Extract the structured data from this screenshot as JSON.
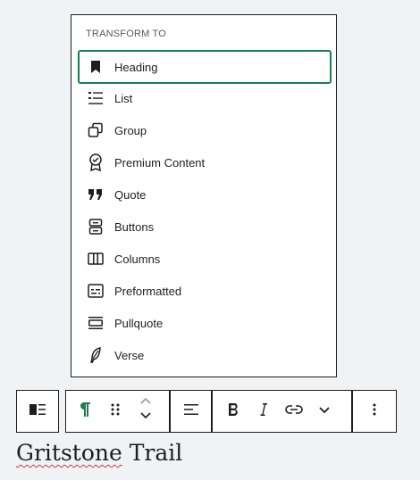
{
  "popover": {
    "title": "TRANSFORM TO",
    "items": [
      {
        "label": "Heading",
        "icon": "bookmark-icon",
        "selected": true
      },
      {
        "label": "List",
        "icon": "list-icon"
      },
      {
        "label": "Group",
        "icon": "group-icon"
      },
      {
        "label": "Premium Content",
        "icon": "premium-badge-icon"
      },
      {
        "label": "Quote",
        "icon": "quote-icon"
      },
      {
        "label": "Buttons",
        "icon": "buttons-icon"
      },
      {
        "label": "Columns",
        "icon": "columns-icon"
      },
      {
        "label": "Preformatted",
        "icon": "preformatted-icon"
      },
      {
        "label": "Pullquote",
        "icon": "pullquote-icon"
      },
      {
        "label": "Verse",
        "icon": "feather-icon"
      }
    ]
  },
  "toolbar": {
    "buttons": [
      "block-layout-icon",
      "paragraph-icon",
      "drag-handle-icon",
      "move-up-down-icon",
      "align-left-icon",
      "bold-icon",
      "italic-icon",
      "link-icon",
      "chevron-down-icon",
      "more-options-icon"
    ]
  },
  "content": {
    "title_word1": "Gritstone",
    "title_word2": " Trail"
  },
  "colors": {
    "accent": "#1a7f4e",
    "text": "#1e1e1e",
    "background": "#f0f3f6",
    "spellcheck": "#d63638"
  }
}
